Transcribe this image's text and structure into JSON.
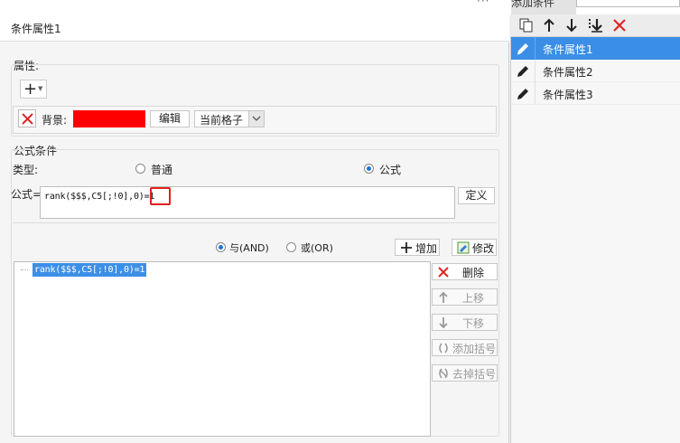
{
  "window": {
    "add_condition_tab": "添加条件",
    "more_dots": "···"
  },
  "header": {
    "title": "条件属性1"
  },
  "properties": {
    "section_label": "属性:",
    "add_symbol": "+",
    "background_label": "背景:",
    "background_color": "#ff0000",
    "edit_button": "编辑",
    "scope_select_value": "当前格子"
  },
  "formula_condition": {
    "section_label": "公式条件",
    "type_label": "类型:",
    "type_options": [
      {
        "label": "普通",
        "selected": false
      },
      {
        "label": "公式",
        "selected": true
      }
    ],
    "formula_label": "公式=",
    "formula_value": "rank($$$,C5[;!0],0)=1",
    "define_button": "定义",
    "logic_options": [
      {
        "label": "与(AND)",
        "selected": true
      },
      {
        "label": "或(OR)",
        "selected": false
      }
    ],
    "add_button": "增加",
    "modify_button": "修改",
    "conditions": [
      "rank($$$,C5[;!0],0)=1"
    ],
    "side_buttons": {
      "delete": "删除",
      "move_up": "上移",
      "move_down": "下移",
      "add_brackets": "添加括号",
      "remove_brackets": "去掉括号"
    }
  },
  "right_panel": {
    "toolbar_icons": [
      "copy-icon",
      "arrow-up-icon",
      "arrow-down-icon",
      "move-bottom-icon",
      "delete-icon"
    ],
    "items": [
      {
        "label": "条件属性1",
        "selected": true
      },
      {
        "label": "条件属性2",
        "selected": false
      },
      {
        "label": "条件属性3",
        "selected": false
      }
    ]
  },
  "colors": {
    "selection": "#3a8ee6",
    "highlight_border": "#e2201c",
    "delete_red": "#e02424"
  }
}
